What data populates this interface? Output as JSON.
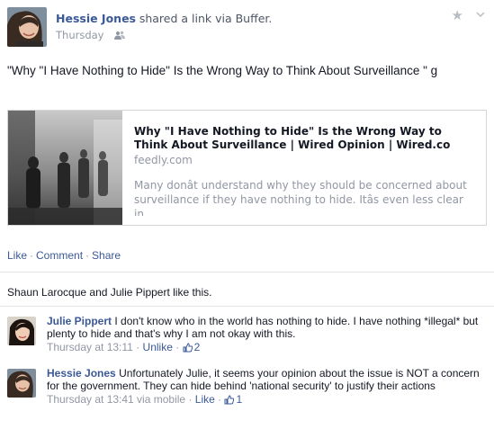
{
  "post": {
    "author": "Hessie Jones",
    "action": "shared a link via Buffer.",
    "timestamp": "Thursday",
    "message": "\"Why \"I Have Nothing to Hide\" Is the Wrong Way to Think About Surveillance \" g"
  },
  "link": {
    "title": "Why \"I Have Nothing to Hide\" Is the Wrong Way to Think About Surveillance | Wired Opinion | Wired.co",
    "domain": "feedly.com",
    "description": "Many donât understand why they should be concerned about surveillance if they have nothing to hide. Itâs even less clear in"
  },
  "actions": {
    "like": "Like",
    "comment": "Comment",
    "share": "Share",
    "sep": "·"
  },
  "likes": {
    "text": "Shaun Larocque and Julie Pippert like this."
  },
  "comments": [
    {
      "author": "Julie Pippert",
      "text": "I don't know who in the world has nothing to hide. I have nothing *illegal* but plenty to hide and that's why I am not okay with this.",
      "time": "Thursday at 13:11",
      "sep": "·",
      "action": "Unlike",
      "likes": "2"
    },
    {
      "author": "Hessie Jones",
      "text": "Unfortunately Julie, it seems your opinion about the issue is NOT a concern for the government. They can hide behind 'national security' to justify their actions",
      "time": "Thursday at 13:41 via mobile",
      "sep": "·",
      "action": "Like",
      "likes": "1"
    }
  ],
  "icons": {
    "star": "star-icon",
    "chevron": "chevron-down-icon",
    "audience": "friends-audience-icon",
    "thumb": "thumbs-up-icon"
  },
  "colors": {
    "link_blue": "#3b5998",
    "meta_grey": "#9197a3",
    "border": "#d3d6db"
  }
}
